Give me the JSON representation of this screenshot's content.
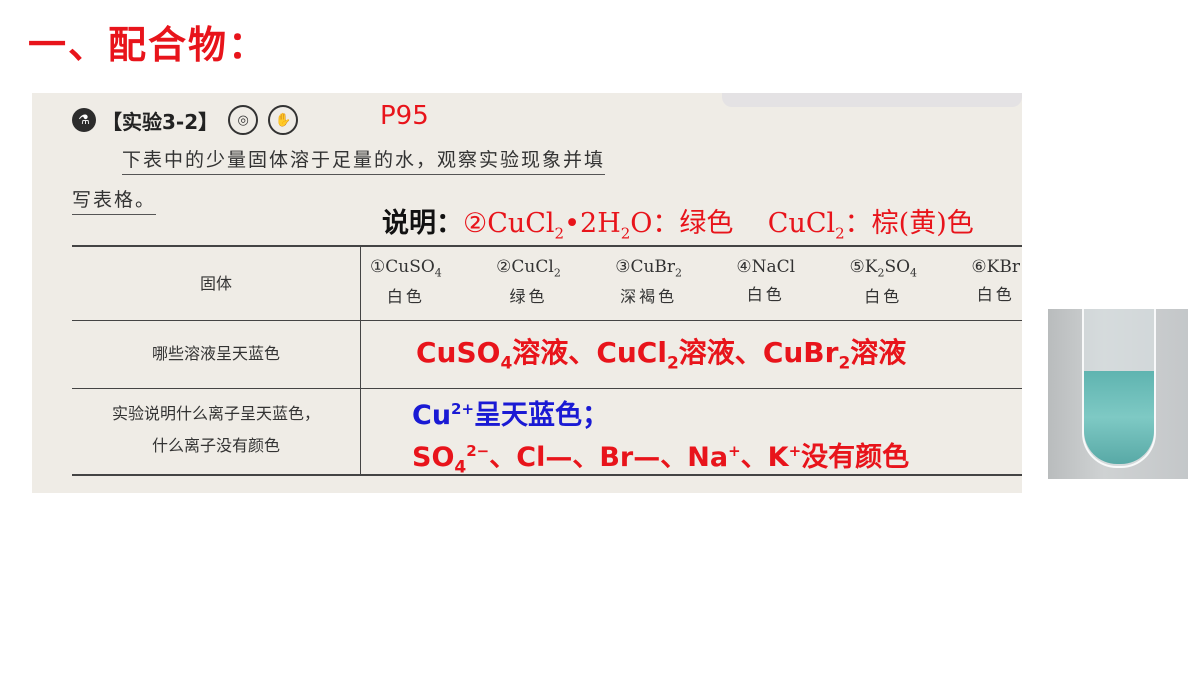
{
  "title": "一、配合物：",
  "experiment": {
    "label": "【实验3-2】",
    "page_ref": "P95",
    "intro_line1": "下表中的少量固体溶于足量的水，观察实验现象并填",
    "intro_line2": "写表格。"
  },
  "note": {
    "lead": "说明：",
    "item1": "②CuCl",
    "item1_sub": "2",
    "item1_mid": "•2H",
    "item1_sub2": "2",
    "item1_tail": "O：绿色",
    "item2": "CuCl",
    "item2_sub": "2",
    "item2_tail": "：棕(黄)色"
  },
  "table": {
    "row_labels": {
      "solid": "固体",
      "blue": "哪些溶液呈天蓝色",
      "explain_1": "实验说明什么离子呈天蓝色，",
      "explain_2": "什么离子没有颜色"
    },
    "solids": [
      {
        "num": "①",
        "formula": "CuSO",
        "sub": "4",
        "color": "白色"
      },
      {
        "num": "②",
        "formula": "CuCl",
        "sub": "2",
        "color": "绿色"
      },
      {
        "num": "③",
        "formula": "CuBr",
        "sub": "2",
        "color": "深褐色"
      },
      {
        "num": "④",
        "formula": "NaCl",
        "sub": "",
        "color": "白色"
      },
      {
        "num": "⑤",
        "formula": "K",
        "sub": "2",
        "formula2": "SO",
        "sub2": "4",
        "color": "白色"
      },
      {
        "num": "⑥",
        "formula": "KBr",
        "sub": "",
        "color": "白色"
      }
    ]
  },
  "answers": {
    "blue_solutions": {
      "a": "CuSO",
      "a_sub": "4",
      "a_tail": "溶液、",
      "b": "CuCl",
      "b_sub": "2",
      "b_tail": "溶液、",
      "c": "CuBr",
      "c_sub": "2",
      "c_tail": "溶液"
    },
    "ion_blue": {
      "ion": "Cu",
      "sup": "2+",
      "text": "呈天蓝色；"
    },
    "ions_colorless": {
      "so4": "SO",
      "so4_sub": "4",
      "so4_sup": "2−",
      "sep": "、",
      "cl": "Cl—",
      "br": "Br—",
      "na": "Na",
      "na_sup": "+",
      "k": "K",
      "k_sup": "+",
      "tail": "没有颜色"
    }
  },
  "colors": {
    "red": "#e8141b",
    "blue": "#1a1ad4",
    "liquid": "#6fbfba"
  }
}
